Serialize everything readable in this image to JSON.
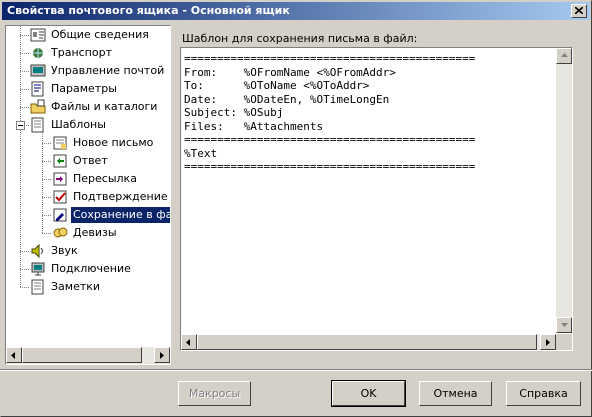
{
  "window": {
    "title": "Свойства почтового ящика - Основной ящик"
  },
  "tree": {
    "items": [
      {
        "label": "Общие сведения",
        "icon": "info-card-icon",
        "level": 0
      },
      {
        "label": "Транспорт",
        "icon": "transport-icon",
        "level": 0
      },
      {
        "label": "Управление почтой",
        "icon": "mail-management-icon",
        "level": 0
      },
      {
        "label": "Параметры",
        "icon": "parameters-icon",
        "level": 0
      },
      {
        "label": "Файлы и каталоги",
        "icon": "folders-icon",
        "level": 0
      },
      {
        "label": "Шаблоны",
        "icon": "templates-icon",
        "level": 0,
        "expanded": true
      },
      {
        "label": "Новое письмо",
        "icon": "new-letter-icon",
        "level": 1
      },
      {
        "label": "Ответ",
        "icon": "reply-icon",
        "level": 1
      },
      {
        "label": "Пересылка",
        "icon": "forward-icon",
        "level": 1
      },
      {
        "label": "Подтверждение про",
        "icon": "confirmation-icon",
        "level": 1
      },
      {
        "label": "Сохранение в файл",
        "icon": "save-to-file-icon",
        "level": 1,
        "selected": true
      },
      {
        "label": "Девизы",
        "icon": "mottos-icon",
        "level": 1
      },
      {
        "label": "Звук",
        "icon": "sound-icon",
        "level": 0
      },
      {
        "label": "Подключение",
        "icon": "connection-icon",
        "level": 0
      },
      {
        "label": "Заметки",
        "icon": "notes-icon",
        "level": 0
      }
    ]
  },
  "template": {
    "label": "Шаблон для сохранения письма в файл:",
    "content": "============================================\nFrom:    %OFromName <%OFromAddr>\nTo:      %OToName <%OToAddr>\nDate:    %ODateEn, %OTimeLongEn\nSubject: %OSubj\nFiles:   %Attachments\n============================================\n%Text\n============================================"
  },
  "buttons": {
    "macros": "Макросы",
    "ok": "OK",
    "cancel": "Отмена",
    "help": "Справка"
  },
  "colors": {
    "titlebar_start": "#0a246a",
    "titlebar_end": "#a6caf0",
    "selection": "#0a246a",
    "face": "#d4d0c8"
  }
}
